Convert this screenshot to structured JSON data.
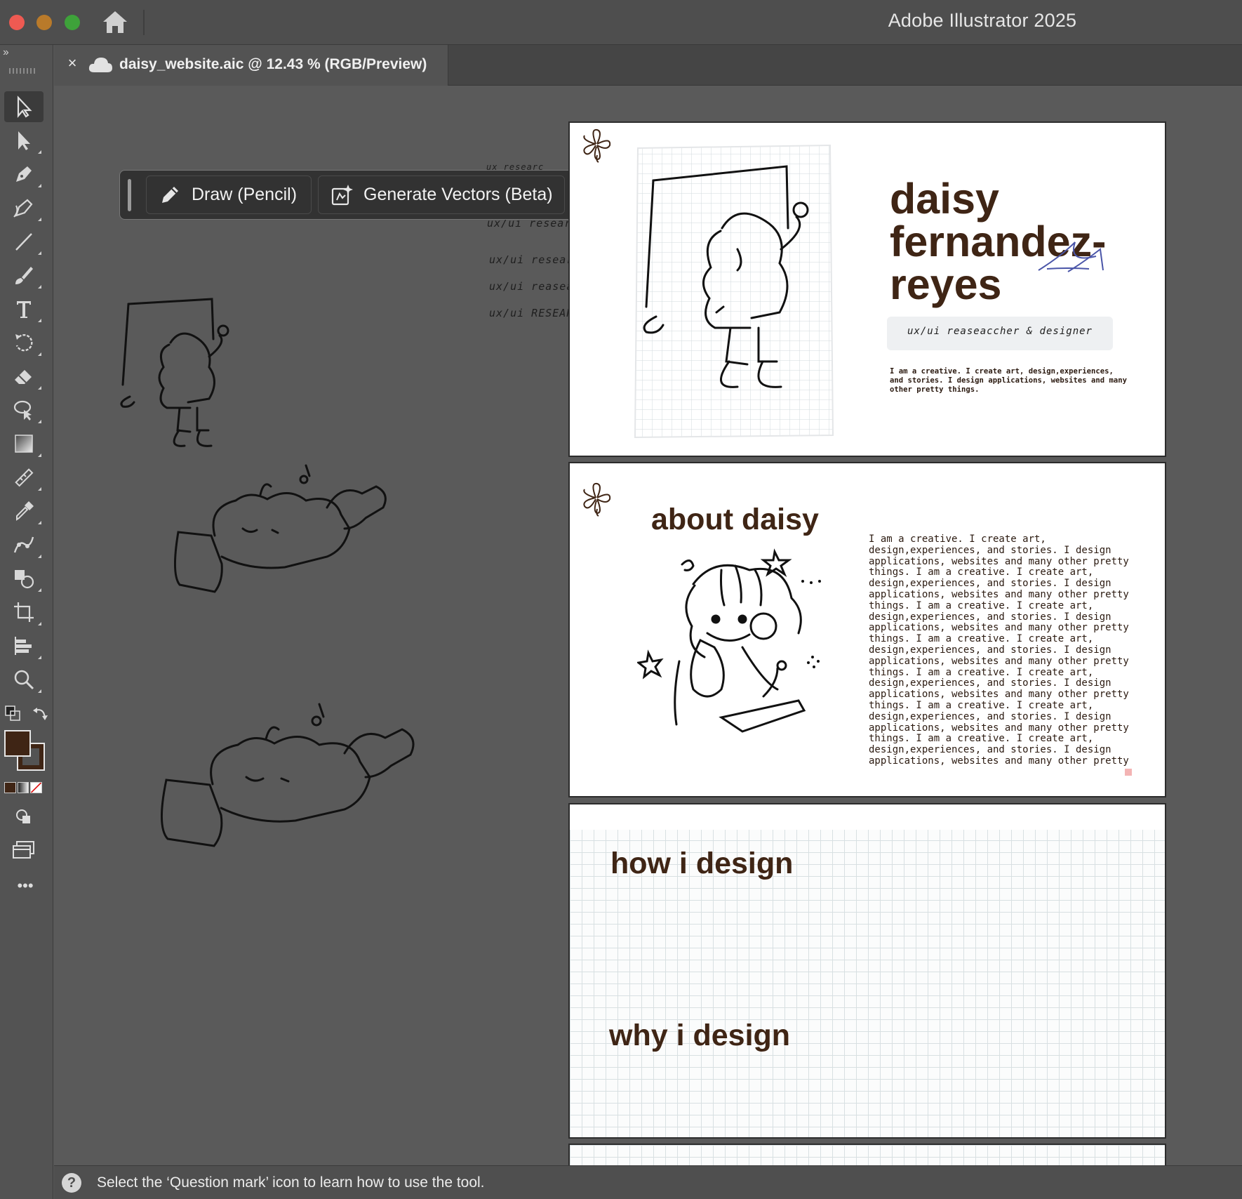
{
  "app": {
    "title": "Adobe Illustrator 2025"
  },
  "document_tab": {
    "label": "daisy_website.aic @ 12.43 % (RGB/Preview)",
    "close": "×"
  },
  "context_bar": {
    "draw_label": "Draw (Pencil)",
    "generate_label": "Generate Vectors (Beta)",
    "more": "•••"
  },
  "toolbar": {
    "collapse": "››",
    "more": "•••"
  },
  "scribbles": [
    "ux  researc",
    "ux/ui  researcher & des",
    "ux/ui  researcher & de",
    "ux/ui  reaseacher & de",
    "ux/ui  RESEARCHER &"
  ],
  "artboard1": {
    "name_lines": [
      "daisy",
      "fernandez-",
      "reyes"
    ],
    "tagline": "ux/ui  reaseaccher & designer",
    "intro": "I am a creative. I create art, design,experiences, and stories. I design applications, websites and many other pretty things."
  },
  "artboard2": {
    "title": "about daisy",
    "body": "I am a creative. I create art, design,experiences, and stories. I design applications, websites and many other pretty things. I am a creative. I create art, design,experiences, and stories. I design applications, websites and many other pretty things. I am a creative. I create art, design,experiences, and stories. I design applications, websites and many other pretty things. I am a creative. I create art, design,experiences, and stories. I design applications, websites and many other pretty things. I am a creative. I create art, design,experiences, and stories. I design applications, websites and many other pretty things. I am a creative. I create art, design,experiences, and stories. I design applications, websites and many other pretty things. I am a creative. I create art, design,experiences, and stories. I design applications, websites and many other pretty"
  },
  "artboard3": {
    "how_title": "how i design",
    "why_title": "why i design"
  },
  "status": {
    "help": "?",
    "text": "Select the ‘Question mark’ icon to learn how to use the tool."
  },
  "colors": {
    "fill": "#3f2515",
    "text_brown": "#3f2515",
    "ui_dark": "#323232"
  }
}
